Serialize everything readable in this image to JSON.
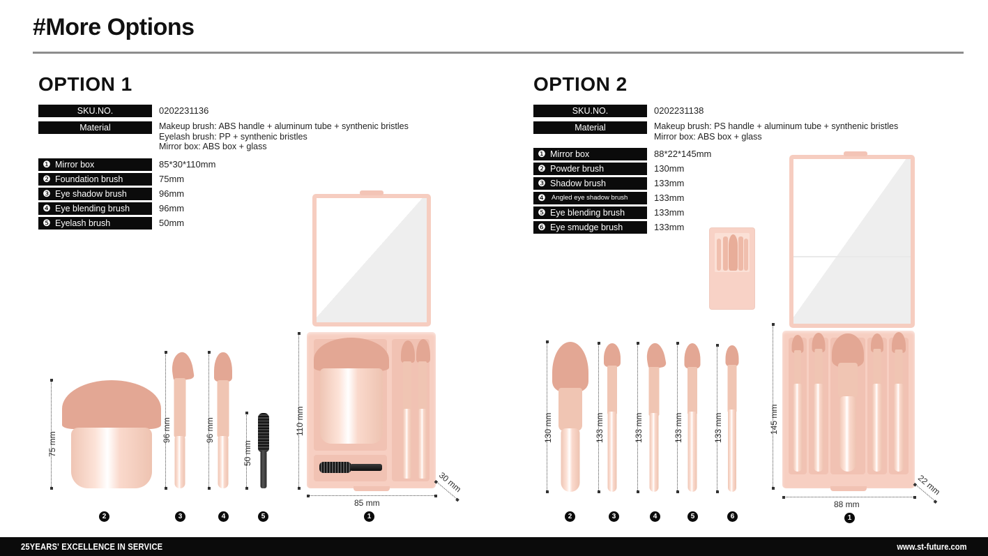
{
  "header": {
    "title": "#More Options"
  },
  "options": [
    {
      "title": "OPTION 1",
      "sku_label": "SKU.NO.",
      "sku_value": "0202231136",
      "material_label": "Material",
      "material_value": "Makeup brush: ABS handle + aluminum tube + synthenic bristles\nEyelash brush: PP + synthenic bristles\nMirror box: ABS box + glass",
      "items": [
        {
          "num": "❶",
          "name": "Mirror box",
          "size": "85*30*110mm"
        },
        {
          "num": "❷",
          "name": "Foundation brush",
          "size": "75mm"
        },
        {
          "num": "❸",
          "name": "Eye shadow brush",
          "size": "96mm"
        },
        {
          "num": "❹",
          "name": "Eye blending brush",
          "size": "96mm"
        },
        {
          "num": "❺",
          "name": "Eyelash brush",
          "size": "50mm"
        }
      ],
      "figure_labels": [
        {
          "badge": "2",
          "dim": "75 mm"
        },
        {
          "badge": "3",
          "dim": "96 mm"
        },
        {
          "badge": "4",
          "dim": "96 mm"
        },
        {
          "badge": "5",
          "dim": "50 mm"
        },
        {
          "badge": "1",
          "dim": "110 mm",
          "width": "85 mm",
          "depth": "30 mm"
        }
      ]
    },
    {
      "title": "OPTION 2",
      "sku_label": "SKU.NO.",
      "sku_value": "0202231138",
      "material_label": "Material",
      "material_value": "Makeup brush:  PS handle + aluminum tube + synthenic bristles\nMirror box: ABS box + glass",
      "items": [
        {
          "num": "❶",
          "name": "Mirror box",
          "size": "88*22*145mm"
        },
        {
          "num": "❷",
          "name": "Powder brush",
          "size": "130mm"
        },
        {
          "num": "❸",
          "name": "Shadow brush",
          "size": "133mm"
        },
        {
          "num": "❹",
          "name": "Angled eye shadow brush",
          "size": "133mm",
          "tiny": true
        },
        {
          "num": "❺",
          "name": "Eye blending brush",
          "size": "133mm"
        },
        {
          "num": "❻",
          "name": "Eye smudge brush",
          "size": "133mm"
        }
      ],
      "figure_labels": [
        {
          "badge": "2",
          "dim": "130 mm"
        },
        {
          "badge": "3",
          "dim": "133 mm"
        },
        {
          "badge": "4",
          "dim": "133 mm"
        },
        {
          "badge": "5",
          "dim": "133 mm"
        },
        {
          "badge": "6",
          "dim": "133 mm"
        },
        {
          "badge": "1",
          "dim": "145 mm",
          "width": "88 mm",
          "depth": "22 mm"
        }
      ]
    }
  ],
  "footer": {
    "tagline": "25YEARS' EXCELLENCE IN SERVICE",
    "website": "www.st-future.com"
  },
  "colors": {
    "accent_pink": "#f7cfc2",
    "bristle": "#e3a794",
    "black": "#0b0b0b",
    "rule": "#8d8d8d"
  }
}
